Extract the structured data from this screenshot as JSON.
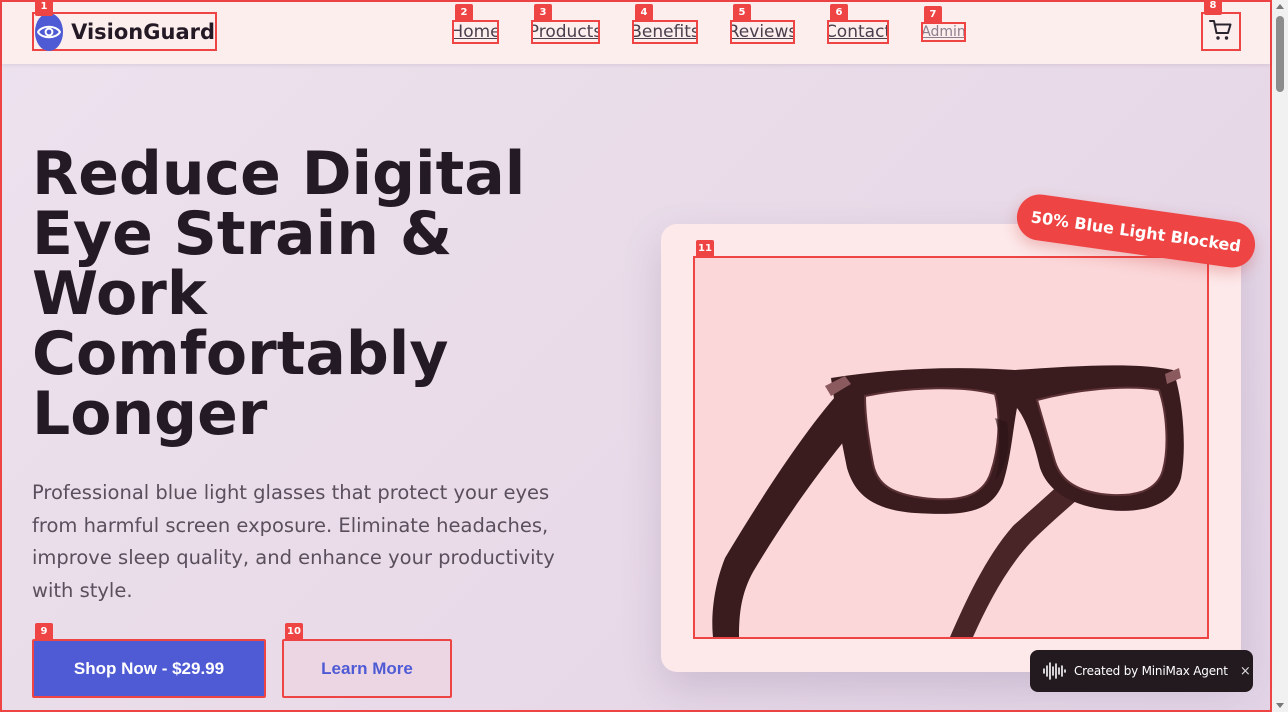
{
  "brand": {
    "name": "VisionGuard",
    "logo_icon": "eye-icon",
    "accent": "#4f5bd5"
  },
  "nav": {
    "links": [
      {
        "label": "Home",
        "marker": "2"
      },
      {
        "label": "Products",
        "marker": "3"
      },
      {
        "label": "Benefits",
        "marker": "4"
      },
      {
        "label": "Reviews",
        "marker": "5"
      },
      {
        "label": "Contact",
        "marker": "6"
      },
      {
        "label": "Admin",
        "marker": "7"
      }
    ],
    "cart_icon": "cart-icon"
  },
  "markers": {
    "logo": "1",
    "cart": "8",
    "shop_button": "9",
    "learn_button": "10",
    "product_image": "11"
  },
  "hero": {
    "title_lines": [
      "Reduce Digital",
      "Eye Strain &",
      "Work",
      "Comfortably",
      "Longer"
    ],
    "description": "Professional blue light glasses that protect your eyes from harmful screen exposure. Eliminate headaches, improve sleep quality, and enhance your productivity with style.",
    "primary_button": "Shop Now - $29.99",
    "secondary_button": "Learn More"
  },
  "product": {
    "badge": "50% Blue Light Blocked",
    "image_subject": "glasses-icon"
  },
  "toast": {
    "text": "Created by MiniMax Agent",
    "close": "×"
  },
  "colors": {
    "marker": "#ef4444",
    "nav_bg": "#fdeeee",
    "card_bg": "#fde9ea",
    "text_dark": "#241a26",
    "toast_bg": "#231a1f"
  }
}
